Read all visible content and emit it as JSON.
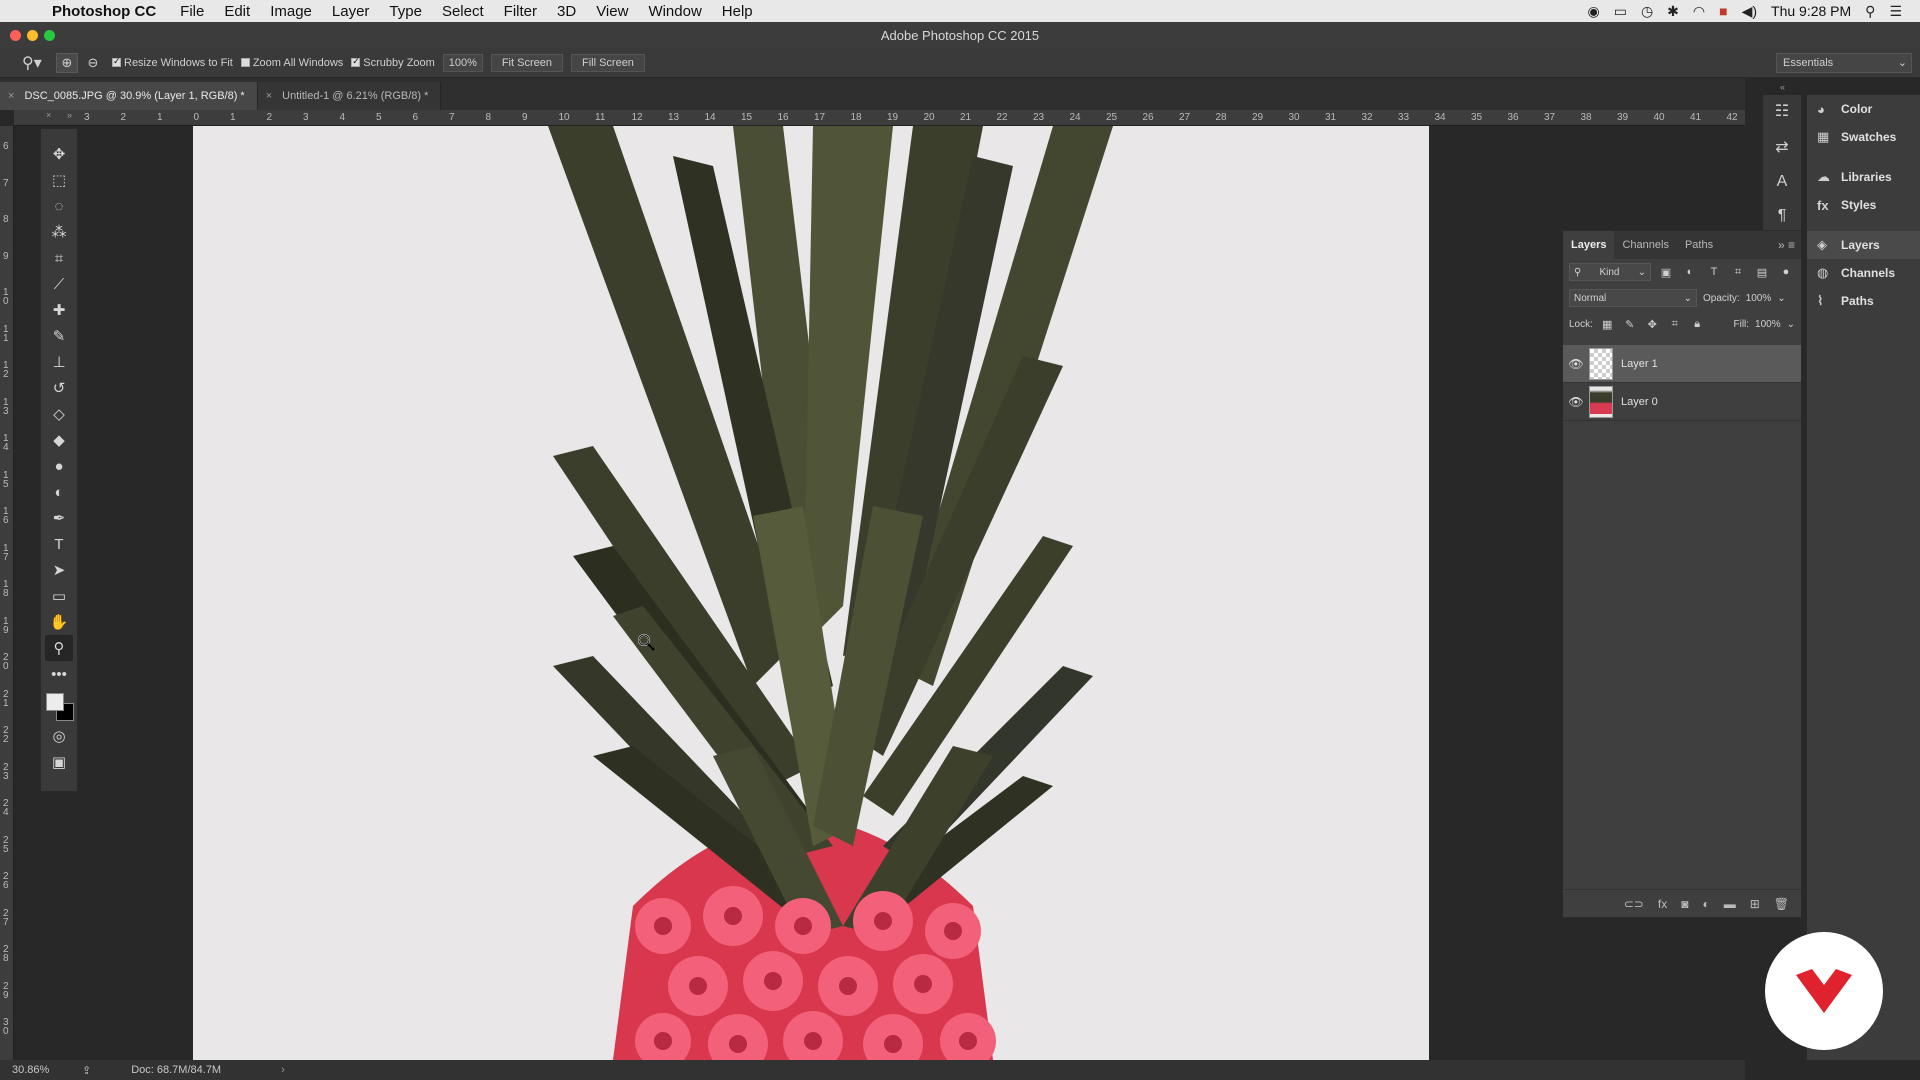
{
  "menubar": {
    "app_name": "Photoshop CC",
    "menus": [
      "File",
      "Edit",
      "Image",
      "Layer",
      "Type",
      "Select",
      "Filter",
      "3D",
      "View",
      "Window",
      "Help"
    ],
    "clock": "Thu 9:28 PM"
  },
  "window": {
    "title": "Adobe Photoshop CC 2015"
  },
  "options": {
    "resize_windows": "Resize Windows to Fit",
    "zoom_all": "Zoom All Windows",
    "scrubby": "Scrubby Zoom",
    "zoom_value": "100%",
    "fit_screen": "Fit Screen",
    "fill_screen": "Fill Screen",
    "workspace": "Essentials"
  },
  "tabs": [
    {
      "label": "DSC_0085.JPG @ 30.9% (Layer 1, RGB/8) *"
    },
    {
      "label": "Untitled-1 @ 6.21% (RGB/8) *"
    }
  ],
  "ruler_top": [
    "3",
    "2",
    "1",
    "0",
    "1",
    "2",
    "3",
    "4",
    "5",
    "6",
    "7",
    "8",
    "9",
    "10",
    "11",
    "12",
    "13",
    "14",
    "15",
    "16",
    "17",
    "18",
    "19",
    "20",
    "21",
    "22",
    "23",
    "24",
    "25",
    "26",
    "27",
    "28",
    "29",
    "30",
    "31",
    "32",
    "33",
    "34",
    "35",
    "36",
    "37",
    "38",
    "39",
    "40",
    "41",
    "42"
  ],
  "ruler_left": [
    "6",
    "7",
    "8",
    "9",
    "1 0",
    "1 1",
    "1 2",
    "1 3",
    "1 4",
    "1 5",
    "1 6",
    "1 7",
    "1 8",
    "1 9",
    "2 0",
    "2 1",
    "2 2",
    "2 3",
    "2 4",
    "2 5",
    "2 6",
    "2 7",
    "2 8",
    "2 9",
    "3 0"
  ],
  "status": {
    "zoom": "30.86%",
    "doc": "Doc: 68.7M/84.7M"
  },
  "dock": {
    "group1": [
      "Color",
      "Swatches"
    ],
    "group2": [
      "Libraries",
      "Styles"
    ],
    "group3": [
      "Layers",
      "Channels",
      "Paths"
    ]
  },
  "layers_panel": {
    "tabs": [
      "Layers",
      "Channels",
      "Paths"
    ],
    "kind": "Kind",
    "blend": "Normal",
    "opacity_label": "Opacity:",
    "opacity": "100%",
    "lock_label": "Lock:",
    "fill_label": "Fill:",
    "fill": "100%",
    "layers": [
      {
        "name": "Layer 1"
      },
      {
        "name": "Layer 0"
      }
    ]
  },
  "colors": {
    "accent_red": "#e0222e",
    "canvas_bg": "#e9e7e8"
  }
}
